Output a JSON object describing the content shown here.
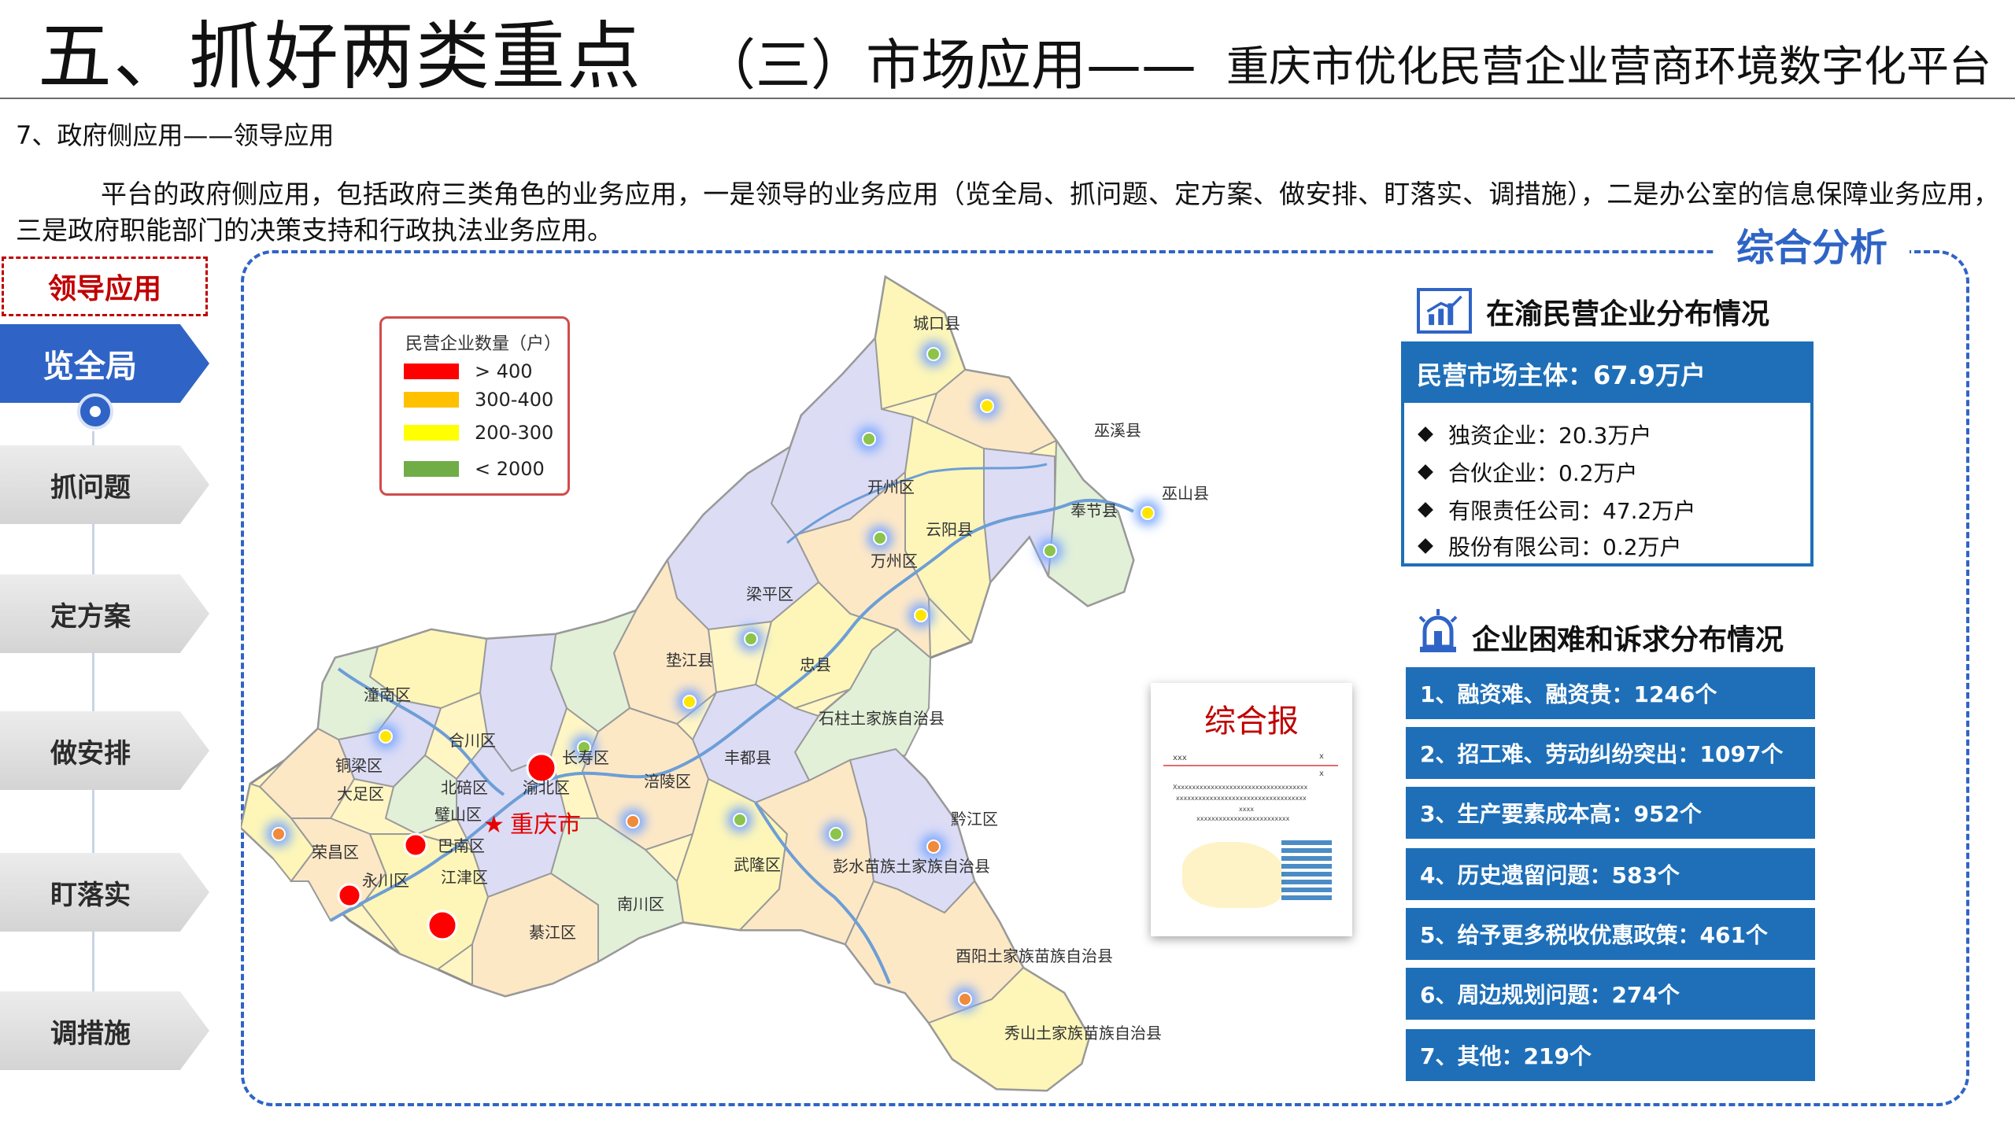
{
  "header": {
    "main": "五、抓好两类重点",
    "sub": "（三）市场应用——",
    "sub2": "重庆市优化民营企业营商环境数字化平台"
  },
  "section_title": "7、政府侧应用——领导应用",
  "intro": "平台的政府侧应用，包括政府三类角色的业务应用，一是领导的业务应用（览全局、抓问题、定方案、做安排、盯落实、调措施），二是办公室的信息保障业务应用，三是政府职能部门的决策支持和行政执法业务应用。",
  "left_nav": {
    "tag": "领导应用",
    "items": [
      {
        "label": "览全局"
      },
      {
        "label": "抓问题"
      },
      {
        "label": "定方案"
      },
      {
        "label": "做安排"
      },
      {
        "label": "盯落实"
      },
      {
        "label": "调措施"
      }
    ]
  },
  "panel_title": "综合分析",
  "map": {
    "legend_title": "民营企业数量（户）",
    "legend": [
      {
        "label": "> 400",
        "color": "#ff0000"
      },
      {
        "label": "300-400",
        "color": "#ffc000"
      },
      {
        "label": "200-300",
        "color": "#ffff00"
      },
      {
        "label": "< 2000",
        "color": "#70ad47"
      }
    ],
    "capital": "重庆市",
    "districts": [
      "城口县",
      "巫溪县",
      "开州区",
      "巫山县",
      "奉节县",
      "云阳县",
      "万州区",
      "梁平区",
      "垫江县",
      "忠县",
      "石柱土家族自治县",
      "潼南区",
      "合川区",
      "铜梁区",
      "大足区",
      "北碚区",
      "渝北区",
      "长寿区",
      "涪陵区",
      "丰都县",
      "璧山区",
      "巴南区",
      "荣昌区",
      "永川区",
      "江津区",
      "綦江区",
      "南川区",
      "武隆区",
      "彭水苗族土家族自治县",
      "黔江区",
      "酉阳土家族苗族自治县",
      "秀山土家族苗族自治县"
    ]
  },
  "report": {
    "title": "综合报",
    "lines": [
      "xxx",
      "x",
      "x",
      "Xxxxxxxxxxxxxxxxxxxxxxxxxxxxxxxxxxxx",
      "xxxxxxxxxxxxxxxxxxxxxxxxxxxxxxxxxxx",
      "xxxx",
      "xxxxxxxxxxxxxxxxxxxxxxxxx"
    ]
  },
  "distribution": {
    "title": "在渝民营企业分布情况",
    "head": "民营市场主体：67.9万户",
    "items": [
      "独资企业：20.3万户",
      "合伙企业：0.2万户",
      "有限责任公司：47.2万户",
      "股份有限公司：0.2万户"
    ]
  },
  "needs": {
    "title": "企业困难和诉求分布情况",
    "items": [
      "1、融资难、融资贵：1246个",
      "2、招工难、劳动纠纷突出：1097个",
      "3、生产要素成本高：952个",
      "4、历史遗留问题：583个",
      "5、给予更多税收优惠政策：461个",
      "6、周边规划问题：274个",
      "7、其他：219个"
    ]
  }
}
